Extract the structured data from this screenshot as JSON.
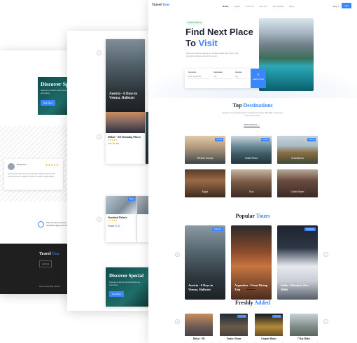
{
  "page_left": {
    "promo": {
      "title": "Discover Spe",
      "desc": "Ideas are to sketch and think about new promotions",
      "button": "See More"
    },
    "review": {
      "name": "David Kim",
      "stars": "★★★★★",
      "text": "Lorem ipsum dolor sit amet consectetur adipiscing elit sed do eiusmod tempor incididunt ut labore et dolore magna aliqua"
    },
    "contact": {
      "text": "Zhiv Develop Andrew, Nahlibrand@gmail.com"
    },
    "footer": {
      "logo_a": "Travel",
      "logo_b": "Tour",
      "button": "Join Us",
      "links": "Home   About   Blog   Contact"
    }
  },
  "page_middle": {
    "hero_card": {
      "title": "Austria - 6 Days in Vienna, Hallstatt"
    },
    "dubai": {
      "title": "Dubai - All Stunning Places",
      "stars": "★★★★★",
      "price": "from $1,999"
    },
    "hotel": {
      "tag": "Hotel",
      "title": "Standard Deluxe",
      "stars": "★★★★★",
      "price_label": "From",
      "price": "$75"
    },
    "promo": {
      "title": "Discover Special",
      "desc": "Ideas are to sketch and think about new promotions",
      "button": "See More"
    }
  },
  "page_right": {
    "nav": {
      "logo_a": "Travel",
      "logo_b": "Tour",
      "items": [
        "Home",
        "Pages",
        "Tour List",
        "Tour List",
        "Tour Details",
        "Blog"
      ],
      "lang": "Eng ∨",
      "login": "Login"
    },
    "hero": {
      "pill": "Explore With us",
      "title_line1": "Find Next Place",
      "title_line2_a": "To",
      "title_line2_b": "Visit",
      "desc": "Discover amazing places at exclusive deals. Eat, Shop, visit interesting places around the world.",
      "search": {
        "f1_label": "Keywords",
        "f1_value": "Enter Keywords",
        "f2_label": "Destination",
        "f2_value": "Any",
        "f3_label": "Duration",
        "f3_value": "Any",
        "button": "Search Now"
      }
    },
    "destinations": {
      "title_a": "Top",
      "title_b": "Destinations",
      "desc": "Explore our top destinations voted by more than 100,000+ customers around the world.",
      "all": "All Destinations  →",
      "tiles": [
        {
          "label": "Western Europe",
          "tag": "9 Tours"
        },
        {
          "label": "South Africa",
          "tag": "6 Tours"
        },
        {
          "label": "Scandinavia",
          "tag": "3 Tours"
        },
        {
          "label": "Egypt",
          "tag": ""
        },
        {
          "label": "Asia",
          "tag": ""
        },
        {
          "label": "United States",
          "tag": ""
        }
      ]
    },
    "tours": {
      "title_a": "Popular",
      "title_b": "Tours",
      "cards": [
        {
          "title": "Austria - 6 Days in Vienna, Hallstatt",
          "tag": "Featured"
        },
        {
          "title": "Argentina - Great Diving Trip",
          "tag": ""
        },
        {
          "title": "India - Mumbai, New Delhi",
          "tag": "Featured"
        }
      ],
      "view_more": "View More"
    },
    "fresh": {
      "title_a": "Freshly",
      "title_b": "Added",
      "cards": [
        {
          "title": "Dubai - All",
          "tag": ""
        },
        {
          "title": "Venice, Rome",
          "tag": "Featured"
        },
        {
          "title": "Empire Ruins",
          "tag": "Featured"
        },
        {
          "title": "7 Day Rides",
          "tag": ""
        }
      ]
    }
  }
}
